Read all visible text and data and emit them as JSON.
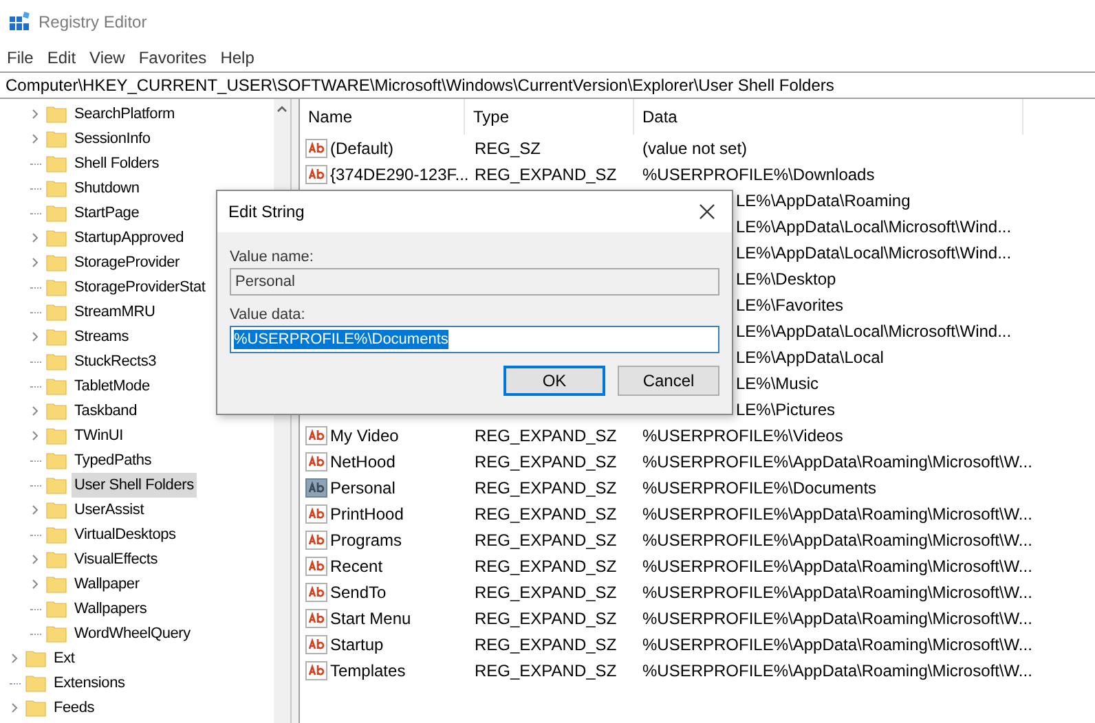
{
  "window": {
    "title": "Registry Editor"
  },
  "menu": [
    "File",
    "Edit",
    "View",
    "Favorites",
    "Help"
  ],
  "address": "Computer\\HKEY_CURRENT_USER\\SOFTWARE\\Microsoft\\Windows\\CurrentVersion\\Explorer\\User Shell Folders",
  "tree": [
    {
      "children": [
        {
          "label": "SearchPlatform",
          "expandable": true,
          "selected": false
        },
        {
          "label": "SessionInfo",
          "expandable": true,
          "selected": false
        },
        {
          "label": "Shell Folders",
          "expandable": false,
          "selected": false
        },
        {
          "label": "Shutdown",
          "expandable": false,
          "selected": false
        },
        {
          "label": "StartPage",
          "expandable": false,
          "selected": false
        },
        {
          "label": "StartupApproved",
          "expandable": true,
          "selected": false
        },
        {
          "label": "StorageProvider",
          "expandable": true,
          "selected": false
        },
        {
          "label": "StorageProviderStat",
          "expandable": false,
          "selected": false
        },
        {
          "label": "StreamMRU",
          "expandable": false,
          "selected": false
        },
        {
          "label": "Streams",
          "expandable": true,
          "selected": false
        },
        {
          "label": "StuckRects3",
          "expandable": false,
          "selected": false
        },
        {
          "label": "TabletMode",
          "expandable": false,
          "selected": false
        },
        {
          "label": "Taskband",
          "expandable": true,
          "selected": false
        },
        {
          "label": "TWinUI",
          "expandable": true,
          "selected": false
        },
        {
          "label": "TypedPaths",
          "expandable": false,
          "selected": false
        },
        {
          "label": "User Shell Folders",
          "expandable": false,
          "selected": true
        },
        {
          "label": "UserAssist",
          "expandable": true,
          "selected": false
        },
        {
          "label": "VirtualDesktops",
          "expandable": false,
          "selected": false
        },
        {
          "label": "VisualEffects",
          "expandable": true,
          "selected": false
        },
        {
          "label": "Wallpaper",
          "expandable": true,
          "selected": false
        },
        {
          "label": "Wallpapers",
          "expandable": false,
          "selected": false
        },
        {
          "label": "WordWheelQuery",
          "expandable": false,
          "selected": false
        }
      ]
    },
    {
      "label": "Ext",
      "expandable": true,
      "selected": false
    },
    {
      "label": "Extensions",
      "expandable": false,
      "selected": false
    },
    {
      "label": "Feeds",
      "expandable": true,
      "selected": false
    }
  ],
  "table": {
    "columns": [
      "Name",
      "Type",
      "Data"
    ],
    "rows": [
      {
        "kind": "full",
        "name": "(Default)",
        "type": "REG_SZ",
        "data": "(value not set)",
        "selected": false
      },
      {
        "kind": "full",
        "name": "{374DE290-123F...",
        "type": "REG_EXPAND_SZ",
        "data": "%USERPROFILE%\\Downloads",
        "selected": false
      },
      {
        "kind": "covered",
        "data": "LE%\\AppData\\Roaming"
      },
      {
        "kind": "covered",
        "data": "LE%\\AppData\\Local\\Microsoft\\Wind..."
      },
      {
        "kind": "covered",
        "data": "LE%\\AppData\\Local\\Microsoft\\Wind..."
      },
      {
        "kind": "covered",
        "data": "LE%\\Desktop"
      },
      {
        "kind": "covered",
        "data": "LE%\\Favorites"
      },
      {
        "kind": "covered",
        "data": "LE%\\AppData\\Local\\Microsoft\\Wind..."
      },
      {
        "kind": "covered",
        "data": "LE%\\AppData\\Local"
      },
      {
        "kind": "covered",
        "data": "LE%\\Music"
      },
      {
        "kind": "covered",
        "data": "LE%\\Pictures"
      },
      {
        "kind": "full",
        "name": "My Video",
        "type": "REG_EXPAND_SZ",
        "data": "%USERPROFILE%\\Videos",
        "selected": false
      },
      {
        "kind": "full",
        "name": "NetHood",
        "type": "REG_EXPAND_SZ",
        "data": "%USERPROFILE%\\AppData\\Roaming\\Microsoft\\W...",
        "selected": false
      },
      {
        "kind": "full",
        "name": "Personal",
        "type": "REG_EXPAND_SZ",
        "data": "%USERPROFILE%\\Documents",
        "selected": true
      },
      {
        "kind": "full",
        "name": "PrintHood",
        "type": "REG_EXPAND_SZ",
        "data": "%USERPROFILE%\\AppData\\Roaming\\Microsoft\\W...",
        "selected": false
      },
      {
        "kind": "full",
        "name": "Programs",
        "type": "REG_EXPAND_SZ",
        "data": "%USERPROFILE%\\AppData\\Roaming\\Microsoft\\W...",
        "selected": false
      },
      {
        "kind": "full",
        "name": "Recent",
        "type": "REG_EXPAND_SZ",
        "data": "%USERPROFILE%\\AppData\\Roaming\\Microsoft\\W...",
        "selected": false
      },
      {
        "kind": "full",
        "name": "SendTo",
        "type": "REG_EXPAND_SZ",
        "data": "%USERPROFILE%\\AppData\\Roaming\\Microsoft\\W...",
        "selected": false
      },
      {
        "kind": "full",
        "name": "Start Menu",
        "type": "REG_EXPAND_SZ",
        "data": "%USERPROFILE%\\AppData\\Roaming\\Microsoft\\W...",
        "selected": false
      },
      {
        "kind": "full",
        "name": "Startup",
        "type": "REG_EXPAND_SZ",
        "data": "%USERPROFILE%\\AppData\\Roaming\\Microsoft\\W...",
        "selected": false
      },
      {
        "kind": "full",
        "name": "Templates",
        "type": "REG_EXPAND_SZ",
        "data": "%USERPROFILE%\\AppData\\Roaming\\Microsoft\\W...",
        "selected": false
      }
    ]
  },
  "dialog": {
    "title": "Edit String",
    "name_label": "Value name:",
    "name_value": "Personal",
    "data_label": "Value data:",
    "data_value": "%USERPROFILE%\\Documents",
    "data_selected": true,
    "buttons": [
      "OK",
      "Cancel"
    ]
  }
}
